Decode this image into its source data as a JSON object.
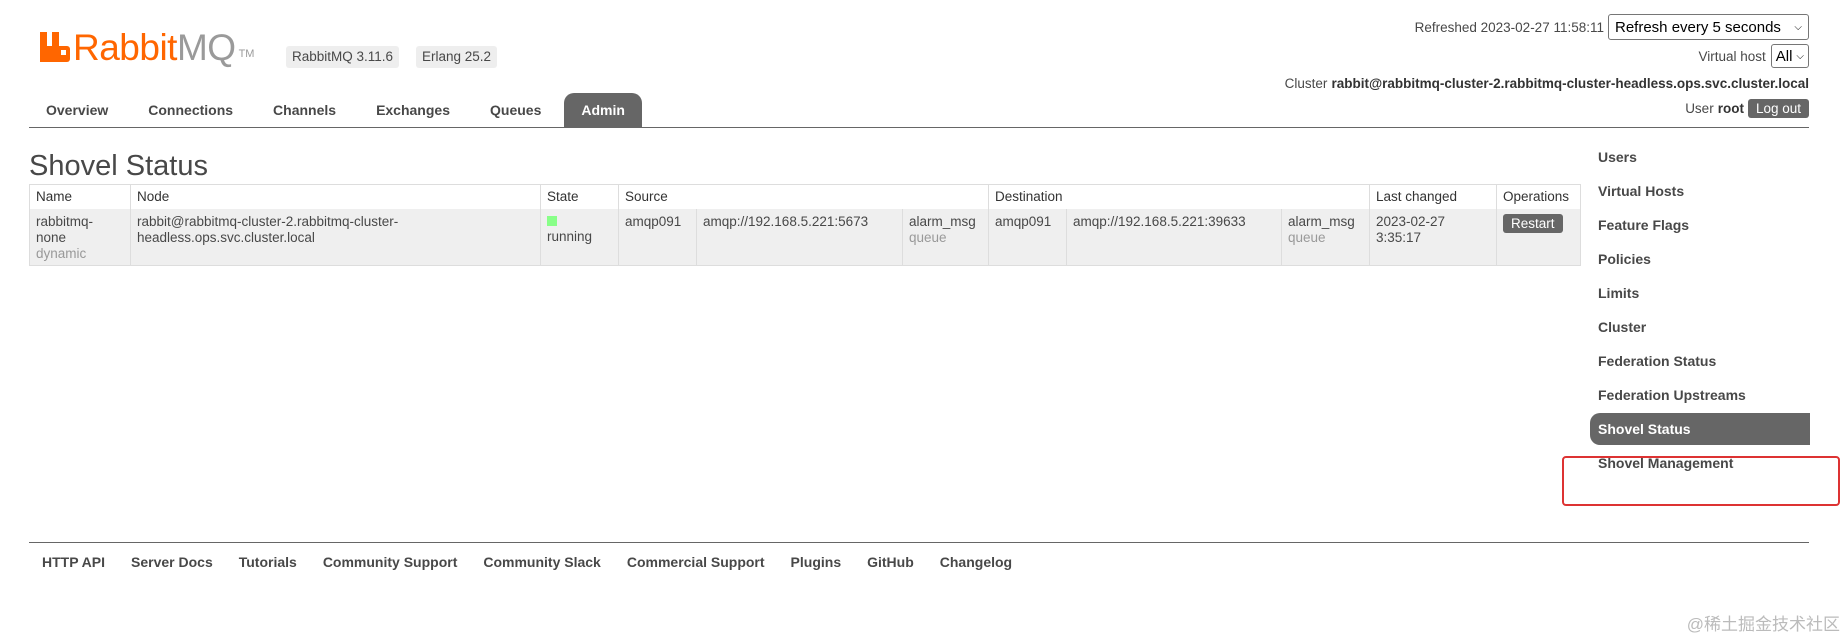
{
  "app": {
    "logo_word_1": "Rabbit",
    "logo_word_2": "MQ",
    "logo_tm": "TM",
    "version": "RabbitMQ 3.11.6",
    "erlang": "Erlang 25.2"
  },
  "header": {
    "refreshed_label": "Refreshed 2023-02-27 11:58:11",
    "refresh_select": "Refresh every 5 seconds",
    "vhost_label": "Virtual host",
    "vhost_select": "All",
    "cluster_label": "Cluster",
    "cluster_name": "rabbit@rabbitmq-cluster-2.rabbitmq-cluster-headless.ops.svc.cluster.local",
    "user_label": "User",
    "user_name": "root",
    "logout_label": "Log out"
  },
  "tabs": [
    {
      "label": "Overview",
      "active": false
    },
    {
      "label": "Connections",
      "active": false
    },
    {
      "label": "Channels",
      "active": false
    },
    {
      "label": "Exchanges",
      "active": false
    },
    {
      "label": "Queues",
      "active": false
    },
    {
      "label": "Admin",
      "active": true
    }
  ],
  "page": {
    "title": "Shovel Status"
  },
  "table": {
    "headers": {
      "name": "Name",
      "node": "Node",
      "state": "State",
      "source": "Source",
      "destination": "Destination",
      "last_changed": "Last changed",
      "operations": "Operations"
    },
    "rows": [
      {
        "name": "rabbitmq-none",
        "name_line1": "rabbitmq-",
        "name_line2": "none",
        "type": "dynamic",
        "node_line1": "rabbit@rabbitmq-cluster-2.rabbitmq-cluster-",
        "node_line2": "headless.ops.svc.cluster.local",
        "state": "running",
        "state_color": "#88ff88",
        "src_protocol": "amqp091",
        "src_uri": "amqp://192.168.5.221:5673",
        "src_name": "alarm_msg",
        "src_kind": "queue",
        "dest_protocol": "amqp091",
        "dest_uri": "amqp://192.168.5.221:39633",
        "dest_name": "alarm_msg",
        "dest_kind": "queue",
        "last_changed_date": "2023-02-27",
        "last_changed_time": "3:35:17",
        "operation_label": "Restart"
      }
    ]
  },
  "sidebar": {
    "items": [
      {
        "label": "Users",
        "active": false
      },
      {
        "label": "Virtual Hosts",
        "active": false
      },
      {
        "label": "Feature Flags",
        "active": false
      },
      {
        "label": "Policies",
        "active": false
      },
      {
        "label": "Limits",
        "active": false
      },
      {
        "label": "Cluster",
        "active": false
      },
      {
        "label": "Federation Status",
        "active": false
      },
      {
        "label": "Federation Upstreams",
        "active": false
      },
      {
        "label": "Shovel Status",
        "active": true
      },
      {
        "label": "Shovel Management",
        "active": false
      }
    ]
  },
  "footer": {
    "links": [
      "HTTP API",
      "Server Docs",
      "Tutorials",
      "Community Support",
      "Community Slack",
      "Commercial Support",
      "Plugins",
      "GitHub",
      "Changelog"
    ]
  },
  "watermark": "@稀土掘金技术社区",
  "colors": {
    "brand": "#ff6600",
    "tab_active": "#666666",
    "highlight": "#dd3333"
  }
}
